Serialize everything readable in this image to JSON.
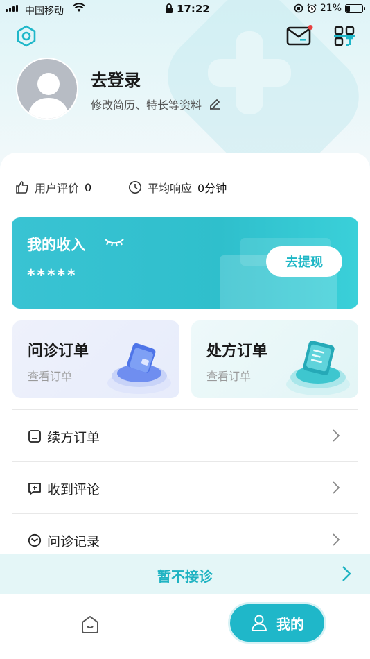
{
  "status_bar": {
    "carrier": "中国移动",
    "time": "17:22",
    "battery": "21%"
  },
  "header": {
    "login_title": "去登录",
    "login_subtitle": "修改简历、特长等资料"
  },
  "stats": {
    "rating_label": "用户评价",
    "rating_value": "0",
    "response_label": "平均响应",
    "response_value": "0分钟"
  },
  "income": {
    "title": "我的收入",
    "amount": "*****",
    "withdraw_label": "去提现"
  },
  "orders": [
    {
      "title": "问诊订单",
      "subtitle": "查看订单"
    },
    {
      "title": "处方订单",
      "subtitle": "查看订单"
    }
  ],
  "menu": [
    {
      "label": "续方订单",
      "icon": "minus-square-icon"
    },
    {
      "label": "收到评论",
      "icon": "plus-comment-icon"
    },
    {
      "label": "问诊记录",
      "icon": "envelope-circle-icon"
    }
  ],
  "pause_bar": {
    "label": "暂不接诊"
  },
  "tabbar": {
    "mine_label": "我的"
  },
  "colors": {
    "accent": "#1fb7c9",
    "card_gradient_start": "#39c3d3",
    "notification_dot": "#e84040"
  }
}
